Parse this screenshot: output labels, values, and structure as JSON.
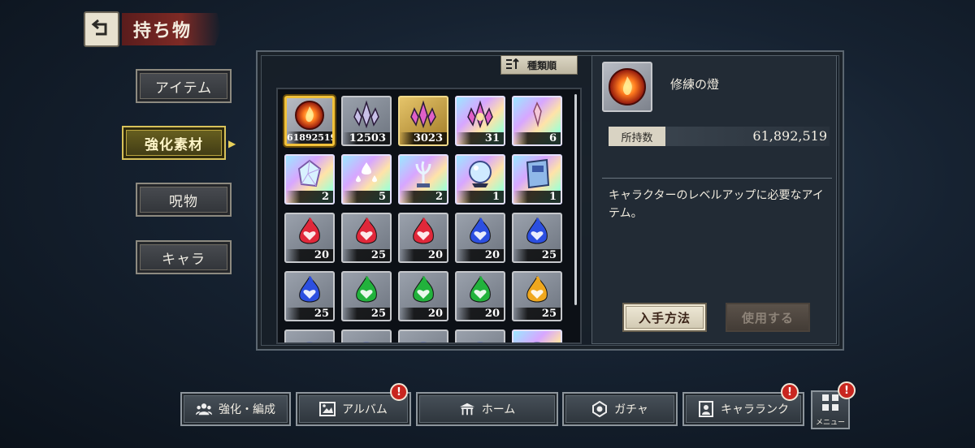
{
  "header": {
    "title": "持ち物"
  },
  "categories": [
    {
      "label": "アイテム",
      "active": false
    },
    {
      "label": "強化素材",
      "active": true
    },
    {
      "label": "呪物",
      "active": false
    },
    {
      "label": "キャラ",
      "active": false
    }
  ],
  "sort": {
    "label": "種類順"
  },
  "items": [
    {
      "icon": "ember-orb-icon",
      "count": "61892519",
      "rarity": "ember",
      "selected": true
    },
    {
      "icon": "small-crystal-cluster-icon",
      "count": "12503",
      "rarity": "silver"
    },
    {
      "icon": "pink-crystal-cluster-icon",
      "count": "3023",
      "rarity": "gold"
    },
    {
      "icon": "large-crystal-burst-icon",
      "count": "31",
      "rarity": "rainbow"
    },
    {
      "icon": "crystal-shard-icon",
      "count": "6",
      "rarity": "rainbow"
    },
    {
      "icon": "prism-stone-icon",
      "count": "2",
      "rarity": "rainbow"
    },
    {
      "icon": "water-droplets-icon",
      "count": "5",
      "rarity": "rainbow"
    },
    {
      "icon": "coral-statue-icon",
      "count": "2",
      "rarity": "rainbow"
    },
    {
      "icon": "crystal-ball-icon",
      "count": "1",
      "rarity": "rainbow"
    },
    {
      "icon": "sp-book-icon",
      "count": "1",
      "rarity": "rainbow"
    },
    {
      "icon": "red-heart-flame-icon",
      "count": "20",
      "rarity": "silver",
      "color": "#e0283a"
    },
    {
      "icon": "red-spade-flame-icon",
      "count": "25",
      "rarity": "silver",
      "color": "#e0283a"
    },
    {
      "icon": "red-club-flame-icon",
      "count": "20",
      "rarity": "silver",
      "color": "#e0283a"
    },
    {
      "icon": "blue-heart-flame-icon",
      "count": "20",
      "rarity": "silver",
      "color": "#2c4fe0"
    },
    {
      "icon": "blue-spade-flame-icon",
      "count": "25",
      "rarity": "silver",
      "color": "#2c4fe0"
    },
    {
      "icon": "blue-club-flame-icon",
      "count": "25",
      "rarity": "silver",
      "color": "#2c4fe0"
    },
    {
      "icon": "green-heart-flame-icon",
      "count": "25",
      "rarity": "silver",
      "color": "#22b23c"
    },
    {
      "icon": "green-spade-flame-icon",
      "count": "20",
      "rarity": "silver",
      "color": "#22b23c"
    },
    {
      "icon": "green-club-flame-icon",
      "count": "20",
      "rarity": "silver",
      "color": "#22b23c"
    },
    {
      "icon": "yellow-heart-flame-icon",
      "count": "25",
      "rarity": "silver",
      "color": "#f0a81e"
    },
    {
      "icon": "partial-item-icon",
      "count": "",
      "rarity": "silver"
    },
    {
      "icon": "partial-item-icon",
      "count": "",
      "rarity": "silver"
    },
    {
      "icon": "partial-item-icon",
      "count": "",
      "rarity": "silver"
    },
    {
      "icon": "partial-item-icon",
      "count": "",
      "rarity": "silver"
    },
    {
      "icon": "partial-item-icon",
      "count": "",
      "rarity": "rainbow"
    }
  ],
  "detail": {
    "name": "修練の燈",
    "owned_label": "所持数",
    "owned_value": "61,892,519",
    "description": "キャラクターのレベルアップに必要なアイテム。",
    "acquire_label": "入手方法",
    "use_label": "使用する"
  },
  "bottom_nav": [
    {
      "label": "強化・編成",
      "icon": "party-icon",
      "badge": false
    },
    {
      "label": "アルバム",
      "icon": "album-icon",
      "badge": true
    },
    {
      "label": "ホーム",
      "icon": "home-icon",
      "badge": false
    },
    {
      "label": "ガチャ",
      "icon": "gacha-icon",
      "badge": false
    },
    {
      "label": "キャラランク",
      "icon": "rank-icon",
      "badge": true
    }
  ],
  "menu": {
    "label": "メニュー",
    "badge": true,
    "badge_text": "!"
  }
}
